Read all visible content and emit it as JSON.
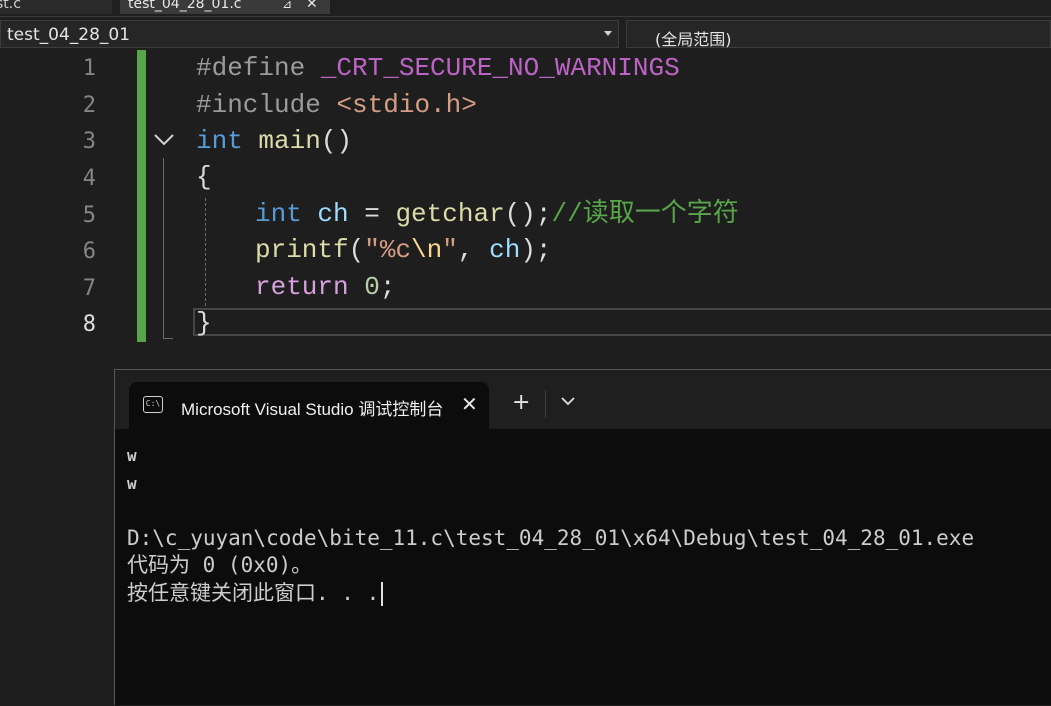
{
  "tabs": {
    "inactive_label": "st.c",
    "active_label": "test_04_28_01.c",
    "pin_glyph": "⊿",
    "close_glyph": "✕"
  },
  "navbar": {
    "project": "test_04_28_01",
    "scope": "(全局范围)"
  },
  "editor": {
    "line_numbers": [
      "1",
      "2",
      "3",
      "4",
      "5",
      "6",
      "7",
      "8"
    ],
    "line1": {
      "pre": "#define",
      "macro": "_CRT_SECURE_NO_WARNINGS"
    },
    "line2": {
      "pre": "#include",
      "inc": "<stdio.h>"
    },
    "line3": {
      "kw": "int",
      "fn": "main",
      "rest": "()"
    },
    "line4": {
      "text": "{"
    },
    "line5": {
      "kw": "int",
      "var": "ch",
      "eq": " = ",
      "fn": "getchar",
      "rest": "();",
      "cmt": "//读取一个字符"
    },
    "line6": {
      "fn": "printf",
      "open": "(",
      "str1": "\"%c",
      "esc": "\\n",
      "str2": "\"",
      "comma": ", ",
      "var": "ch",
      "close": ");"
    },
    "line7": {
      "ctl": "return",
      "num": "0",
      "semi": ";"
    },
    "line8": {
      "text": "}"
    }
  },
  "terminal": {
    "icon_text": "C:\\",
    "tab_title": "Microsoft Visual Studio 调试控制台",
    "close_glyph": "✕",
    "new_tab_glyph": "+",
    "output": [
      "w",
      "w",
      "",
      "D:\\c_yuyan\\code\\bite_11.c\\test_04_28_01\\x64\\Debug\\test_04_28_01.exe",
      "代码为 0 (0x0)。",
      "按任意键关闭此窗口. . ."
    ]
  }
}
